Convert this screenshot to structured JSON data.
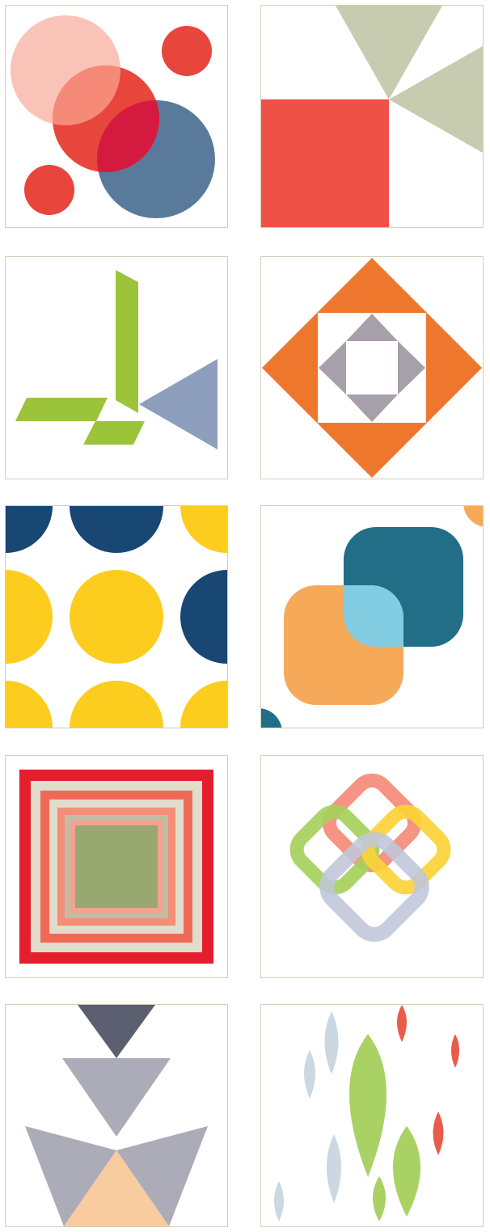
{
  "gallery": {
    "tiles": [
      {
        "id": "overlapping-circles",
        "colors": [
          "#f9c3b8",
          "#e8453c",
          "#5a7a9b",
          "#d51a3f"
        ]
      },
      {
        "id": "square-and-triangles",
        "colors": [
          "#f05147",
          "#c7cbb0"
        ]
      },
      {
        "id": "green-bars-blue-triangle",
        "colors": [
          "#9cc43b",
          "#8e9fbe"
        ]
      },
      {
        "id": "orange-diamond-gray-triangles",
        "colors": [
          "#ed782d",
          "#a7a0ab"
        ]
      },
      {
        "id": "yellow-blue-dots",
        "colors": [
          "#fccd1f",
          "#184773"
        ]
      },
      {
        "id": "rounded-squares",
        "colors": [
          "#f7a95a",
          "#226e87",
          "#83cde2"
        ]
      },
      {
        "id": "concentric-squares",
        "colors": [
          "#e41e2d",
          "#e0ddcd",
          "#ef6a56",
          "#f58e77",
          "#99a770"
        ]
      },
      {
        "id": "interlocking-rounded-diamonds",
        "colors": [
          "#f48b77",
          "#a6d05b",
          "#fbd236",
          "#bfc6d9"
        ]
      },
      {
        "id": "stacked-triangles",
        "colors": [
          "#5c5f70",
          "#abacb8",
          "#f9cca0"
        ]
      },
      {
        "id": "leaf-shapes",
        "colors": [
          "#a9d164",
          "#cbd7e1",
          "#e95c4a"
        ]
      }
    ]
  }
}
